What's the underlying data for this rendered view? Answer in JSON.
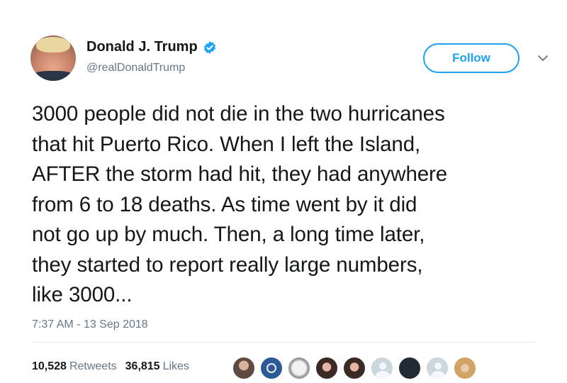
{
  "author": {
    "name": "Donald J. Trump",
    "handle": "@realDonaldTrump",
    "verified": true
  },
  "follow_button": {
    "label": "Follow"
  },
  "tweet": {
    "text": "3000 people did not die in the two hurricanes\nthat hit Puerto Rico. When I left the Island,\nAFTER the storm had hit, they had anywhere\nfrom 6 to 18 deaths. As time went by it did\nnot go up by much. Then, a long time later,\nthey started to report really large numbers,\nlike 3000...",
    "timestamp": "7:37 AM - 13 Sep 2018"
  },
  "stats": {
    "retweets_count": "10,528",
    "retweets_label": "Retweets",
    "likes_count": "36,815",
    "likes_label": "Likes"
  },
  "likers_icons": [
    "avatar-photo-icon",
    "badge-avatar-icon",
    "meme-avatar-icon",
    "avatar-photo-icon",
    "avatar-photo-icon",
    "default-avatar-icon",
    "avatar-photo-icon",
    "default-avatar-icon",
    "avatar-photo-icon"
  ],
  "colors": {
    "accent": "#1da1f2",
    "text": "#14171a",
    "secondary_text": "#657786"
  }
}
